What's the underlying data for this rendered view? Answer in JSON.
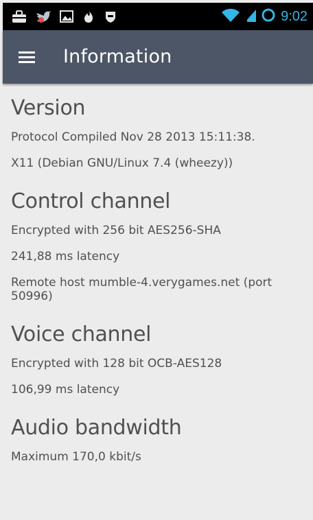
{
  "status_bar": {
    "left_icons": [
      "briefcase-notification-icon",
      "bird-notification-icon",
      "image-notification-icon",
      "flame-notification-icon",
      "shield-notification-icon"
    ],
    "right_icons": [
      "wifi-icon",
      "signal-icon",
      "sync-ring-icon"
    ],
    "time": "9:02"
  },
  "app_bar": {
    "menu_icon": "menu-icon",
    "title": "Information"
  },
  "sections": [
    {
      "title": "Version",
      "rows": [
        "Protocol Compiled Nov 28 2013 15:11:38.",
        "X11 (Debian GNU/Linux 7.4 (wheezy))"
      ]
    },
    {
      "title": "Control channel",
      "rows": [
        "Encrypted with 256 bit AES256-SHA",
        "241,88 ms latency",
        "Remote host mumble-4.verygames.net (port 50996)"
      ]
    },
    {
      "title": "Voice channel",
      "rows": [
        "Encrypted with 128 bit OCB-AES128",
        "106,99 ms latency"
      ]
    },
    {
      "title": "Audio bandwidth",
      "rows": [
        "Maximum 170,0 kbit/s"
      ]
    }
  ],
  "colors": {
    "status_bar_background": "#000000",
    "status_accent": "#33b5e5",
    "app_bar_background": "#4d5666",
    "content_background": "#ececec",
    "text": "#505050"
  }
}
